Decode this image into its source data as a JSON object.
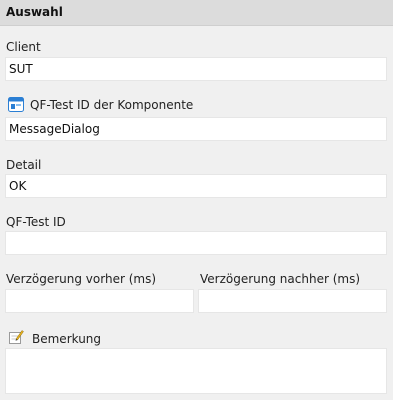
{
  "panel": {
    "title": "Auswahl"
  },
  "client": {
    "label": "Client",
    "value": "SUT"
  },
  "component_id": {
    "label": "QF-Test ID der Komponente",
    "value": "MessageDialog",
    "icon": "component-icon"
  },
  "detail": {
    "label": "Detail",
    "value": "OK"
  },
  "qftest_id": {
    "label": "QF-Test ID",
    "value": ""
  },
  "delay_before": {
    "label": "Verzögerung vorher (ms)",
    "value": ""
  },
  "delay_after": {
    "label": "Verzögerung nachher (ms)",
    "value": ""
  },
  "comment": {
    "label": "Bemerkung",
    "value": "",
    "icon": "note-icon"
  }
}
